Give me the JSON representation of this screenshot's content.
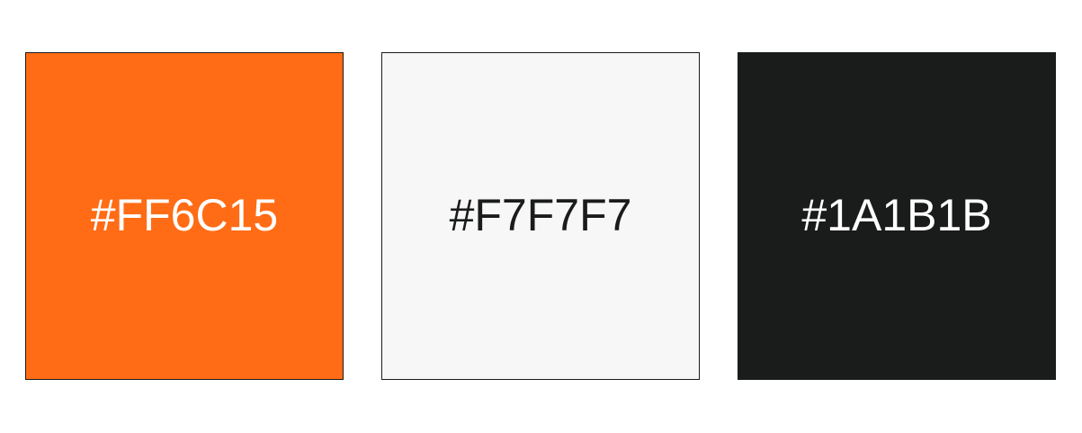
{
  "swatches": [
    {
      "label": "#FF6C15",
      "background": "#FF6C15",
      "text_color": "#FFFFFF"
    },
    {
      "label": "#F7F7F7",
      "background": "#F7F7F7",
      "text_color": "#1A1B1B"
    },
    {
      "label": "#1A1B1B",
      "background": "#1A1B1B",
      "text_color": "#FFFFFF"
    }
  ]
}
